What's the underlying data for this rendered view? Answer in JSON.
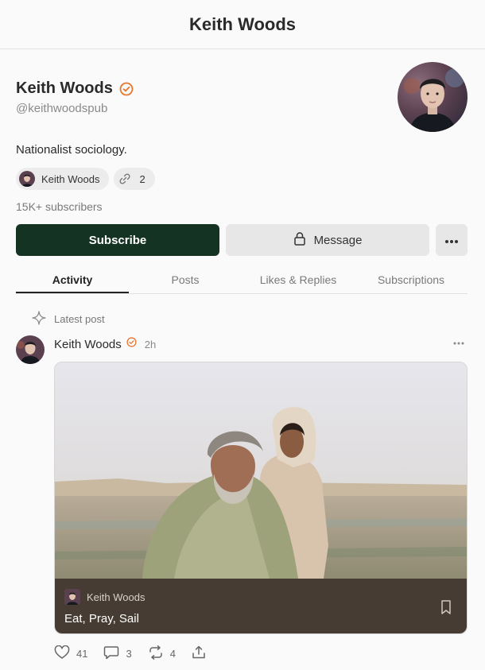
{
  "header": {
    "title": "Keith Woods"
  },
  "profile": {
    "name": "Keith Woods",
    "handle": "@keithwoodspub",
    "bio": "Nationalist sociology.",
    "publication_chip": "Keith Woods",
    "links_count": "2",
    "subscribers": "15K+ subscribers"
  },
  "buttons": {
    "subscribe": "Subscribe",
    "message": "Message"
  },
  "tabs": [
    {
      "label": "Activity"
    },
    {
      "label": "Posts"
    },
    {
      "label": "Likes & Replies"
    },
    {
      "label": "Subscriptions"
    }
  ],
  "feed": {
    "latest_label": "Latest post",
    "post": {
      "author": "Keith Woods",
      "time": "2h",
      "publication": "Keith Woods",
      "title": "Eat, Pray, Sail",
      "likes": "41",
      "comments": "3",
      "restacks": "4"
    }
  },
  "colors": {
    "accent": "#143323",
    "verified": "#e8762c",
    "card_footer": "#463c33"
  }
}
